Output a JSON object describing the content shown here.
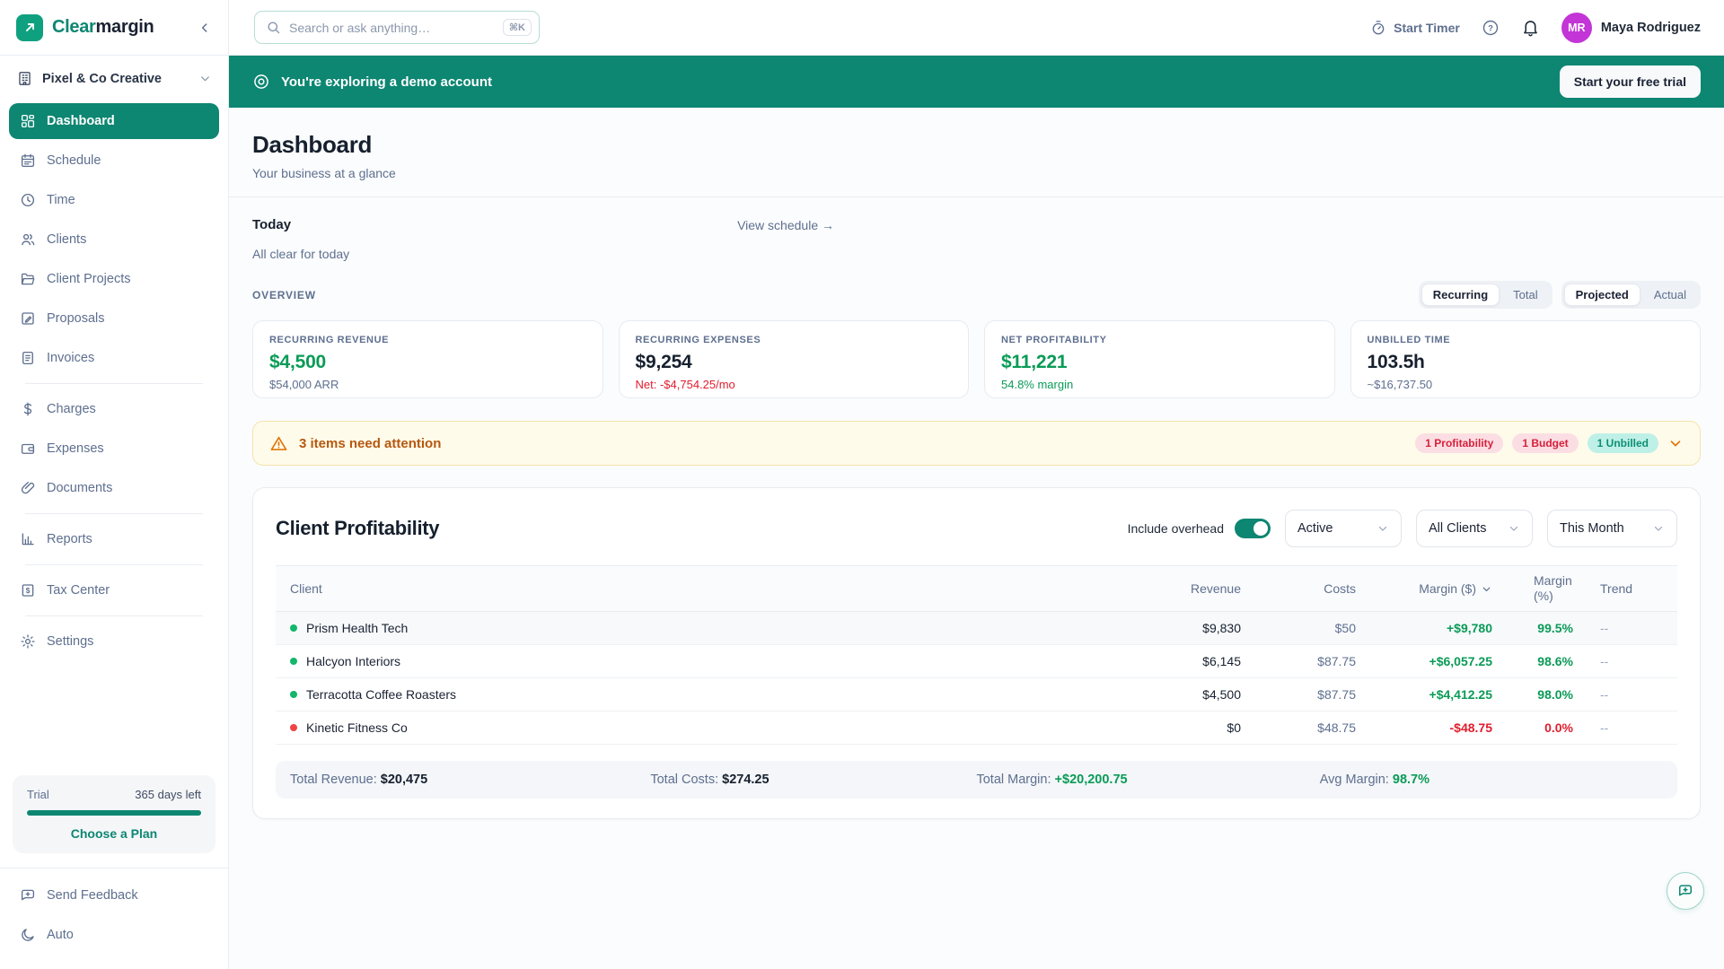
{
  "colors": {
    "brand_teal": "#0D8672",
    "positive_green": "#0A9B57",
    "negative_red": "#E11D2E",
    "warning_orange": "#E1750A",
    "avatar_purple": "#C335D6"
  },
  "brand": {
    "name_part1": "Clear",
    "name_part2": "margin"
  },
  "topbar": {
    "search_placeholder": "Search or ask anything…",
    "search_shortcut": "⌘K",
    "start_timer_label": "Start Timer",
    "user_initials": "MR",
    "user_name": "Maya Rodriguez"
  },
  "banner": {
    "message": "You're exploring a demo account",
    "cta": "Start your free trial"
  },
  "sidebar": {
    "workspace": "Pixel & Co Creative",
    "nav_main": [
      "Dashboard",
      "Schedule",
      "Time",
      "Clients",
      "Client Projects",
      "Proposals",
      "Invoices"
    ],
    "nav_billing": [
      "Charges",
      "Expenses",
      "Documents"
    ],
    "nav_reports": [
      "Reports"
    ],
    "nav_tax": [
      "Tax Center"
    ],
    "nav_settings": [
      "Settings"
    ],
    "trial": {
      "label": "Trial",
      "days_left": "365 days left",
      "cta": "Choose a Plan"
    },
    "footer": [
      "Send Feedback",
      "Auto"
    ]
  },
  "page": {
    "title": "Dashboard",
    "subtitle": "Your business at a glance"
  },
  "today": {
    "title": "Today",
    "link": "View schedule →",
    "empty": "All clear for today"
  },
  "overview": {
    "label": "OVERVIEW",
    "seg1": {
      "active": "Recurring",
      "inactive": "Total"
    },
    "seg2": {
      "active": "Projected",
      "inactive": "Actual"
    },
    "cards": [
      {
        "label": "RECURRING REVENUE",
        "value": "$4,500",
        "sub": "$54,000 ARR"
      },
      {
        "label": "RECURRING EXPENSES",
        "value": "$9,254",
        "sub": "Net: -$4,754.25/mo"
      },
      {
        "label": "NET PROFITABILITY",
        "value": "$11,221",
        "sub": "54.8% margin"
      },
      {
        "label": "UNBILLED TIME",
        "value": "103.5h",
        "sub": "~$16,737.50"
      }
    ]
  },
  "attention": {
    "message": "3 items need attention",
    "badges": [
      {
        "label": "1 Profitability",
        "type": "red"
      },
      {
        "label": "1 Budget",
        "type": "red"
      },
      {
        "label": "1 Unbilled",
        "type": "teal"
      }
    ]
  },
  "profitability": {
    "title": "Client Profitability",
    "overhead_label": "Include overhead",
    "filters": [
      "Active",
      "All Clients",
      "This Month"
    ],
    "columns": [
      "Client",
      "Revenue",
      "Costs",
      "Margin ($)",
      "Margin (%)",
      "Trend"
    ],
    "rows": [
      {
        "client": "Prism Health Tech",
        "status": "green",
        "revenue": "$9,830",
        "costs": "$50",
        "margin": "+$9,780",
        "margin_pct": "99.5%",
        "trend": "--"
      },
      {
        "client": "Halcyon Interiors",
        "status": "green",
        "revenue": "$6,145",
        "costs": "$87.75",
        "margin": "+$6,057.25",
        "margin_pct": "98.6%",
        "trend": "--"
      },
      {
        "client": "Terracotta Coffee Roasters",
        "status": "green",
        "revenue": "$4,500",
        "costs": "$87.75",
        "margin": "+$4,412.25",
        "margin_pct": "98.0%",
        "trend": "--"
      },
      {
        "client": "Kinetic Fitness Co",
        "status": "red",
        "revenue": "$0",
        "costs": "$48.75",
        "margin": "-$48.75",
        "margin_pct": "0.0%",
        "trend": "--"
      }
    ],
    "totals": {
      "revenue_label": "Total Revenue:",
      "revenue": "$20,475",
      "costs_label": "Total Costs:",
      "costs": "$274.25",
      "margin_label": "Total Margin:",
      "margin": "+$20,200.75",
      "avg_label": "Avg Margin:",
      "avg": "98.7%"
    }
  }
}
